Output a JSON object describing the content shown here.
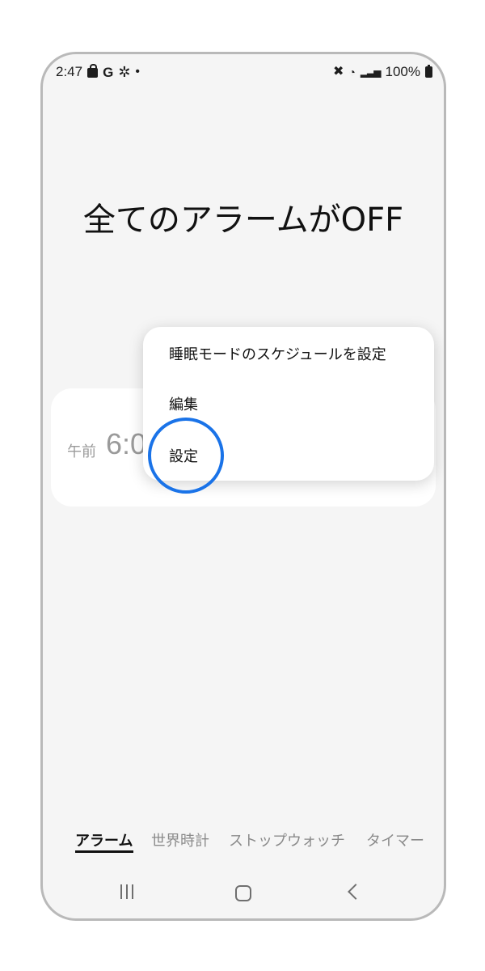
{
  "status_bar": {
    "time": "2:47",
    "g_label": "G",
    "battery_text": "100%",
    "icons": [
      "shopping-bag-icon",
      "g-icon",
      "pinwheel-icon",
      "dot-icon",
      "mute-icon",
      "wifi-icon",
      "signal-icon",
      "battery-icon"
    ]
  },
  "page": {
    "title": "全てのアラームがOFF"
  },
  "alarm_card": {
    "ampm": "午前",
    "time": "6:0"
  },
  "context_menu": {
    "items": [
      {
        "label": "睡眠モードのスケジュールを設定"
      },
      {
        "label": "編集"
      },
      {
        "label": "設定"
      }
    ],
    "highlight_color": "#1a73e8"
  },
  "tabs": [
    {
      "label": "アラーム",
      "active": true
    },
    {
      "label": "世界時計",
      "active": false
    },
    {
      "label": "ストップウォッチ",
      "active": false
    },
    {
      "label": "タイマー",
      "active": false
    }
  ],
  "nav_bar": {
    "icons": [
      "recent-apps-icon",
      "home-icon",
      "back-icon"
    ]
  }
}
